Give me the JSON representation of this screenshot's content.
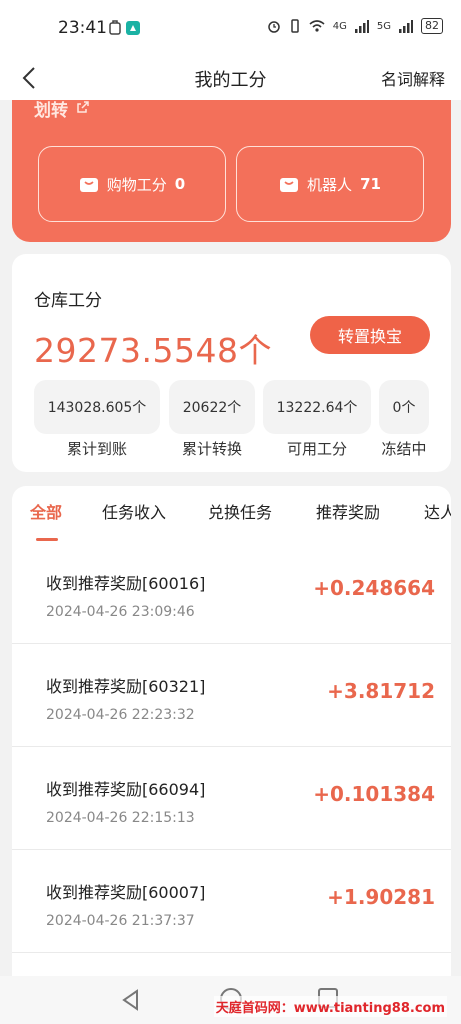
{
  "status_bar": {
    "time": "23:41",
    "signal_4g": "4G",
    "signal_5g": "5G",
    "battery": "82"
  },
  "header": {
    "title": "我的工分",
    "explain_label": "名词解释"
  },
  "top_card": {
    "transfer_label": "划转",
    "shopping_label": "购物工分",
    "shopping_value": "0",
    "robot_label": "机器人",
    "robot_value": "71"
  },
  "warehouse": {
    "title": "仓库工分",
    "total": "29273.5548个",
    "convert_button": "转置换宝",
    "stats": [
      {
        "value": "143028.605个",
        "label": "累计到账"
      },
      {
        "value": "20622个",
        "label": "累计转换"
      },
      {
        "value": "13222.64个",
        "label": "可用工分"
      },
      {
        "value": "0个",
        "label": "冻结中"
      }
    ]
  },
  "tabs": [
    "全部",
    "任务收入",
    "兑换任务",
    "推荐奖励",
    "达人"
  ],
  "records": [
    {
      "title": "收到推荐奖励[60016]",
      "time": "2024-04-26 23:09:46",
      "amount": "+0.248664"
    },
    {
      "title": "收到推荐奖励[60321]",
      "time": "2024-04-26 22:23:32",
      "amount": "+3.81712"
    },
    {
      "title": "收到推荐奖励[66094]",
      "time": "2024-04-26 22:15:13",
      "amount": "+0.101384"
    },
    {
      "title": "收到推荐奖励[60007]",
      "time": "2024-04-26 21:37:37",
      "amount": "+1.90281"
    }
  ],
  "watermark": "天庭首码网：www.tianting88.com",
  "colors": {
    "accent": "#e9674d",
    "card_red": "#f3705a",
    "button_red": "#ef6348"
  }
}
